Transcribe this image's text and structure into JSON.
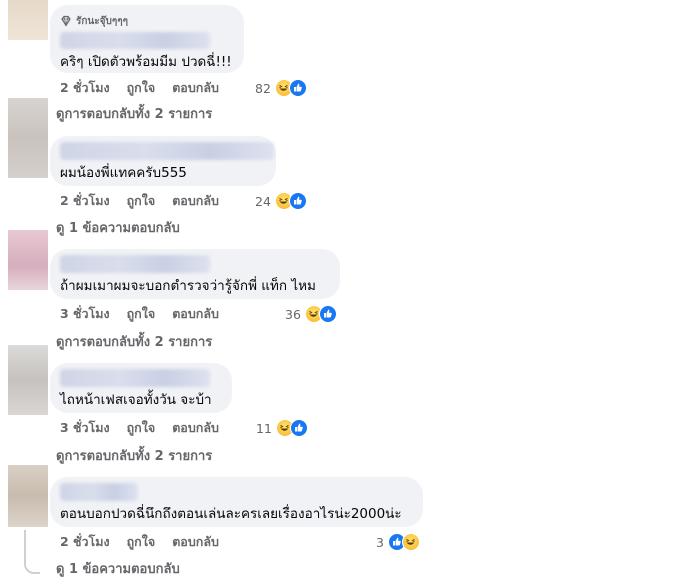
{
  "comments": [
    {
      "badge": "รักนะจุ๊บๆๆๆ",
      "text": "คริๆ เปิดตัวพร้อมมีม ปวดฉี่!!!",
      "time": "2 ชั่วโมง",
      "like_label": "ถูกใจ",
      "reply_label": "ตอบกลับ",
      "reaction_count": "82",
      "replies_label": "ดูการตอบกลับทั้ง 2 รายการ"
    },
    {
      "text": "ผมน้องพี่แทคครับ555",
      "time": "2 ชั่วโมง",
      "like_label": "ถูกใจ",
      "reply_label": "ตอบกลับ",
      "reaction_count": "24",
      "replies_label": "ดู 1 ข้อความตอบกลับ"
    },
    {
      "text": "ถ้าผมเมาผมจะบอกตำรวจว่ารู้จักพี่ แท็ก ไหม",
      "time": "3 ชั่วโมง",
      "like_label": "ถูกใจ",
      "reply_label": "ตอบกลับ",
      "reaction_count": "36",
      "replies_label": "ดูการตอบกลับทั้ง 2 รายการ"
    },
    {
      "text": "ไถหน้าเฟสเจอทั้งวัน จะบ้า",
      "time": "3 ชั่วโมง",
      "like_label": "ถูกใจ",
      "reply_label": "ตอบกลับ",
      "reaction_count": "11",
      "replies_label": "ดูการตอบกลับทั้ง 2 รายการ"
    },
    {
      "text": "ตอนบอกปวดฉี่นึกถึงตอนเล่นละครเลยเรื่องอาไรน่ะ2000น่ะ",
      "time": "2 ชั่วโมง",
      "like_label": "ถูกใจ",
      "reply_label": "ตอบกลับ",
      "reaction_count": "3",
      "replies_label": "ดู 1 ข้อความตอบกลับ"
    }
  ],
  "icons": {
    "badge": "diamond-icon",
    "reaction_laugh": "haha-reaction-icon",
    "reaction_like": "like-reaction-icon"
  },
  "colors": {
    "bubble": "#f0f2f5",
    "secondary_text": "#65676b",
    "like_blue": "#1877f2",
    "laugh_yellow": "#f7b125"
  }
}
